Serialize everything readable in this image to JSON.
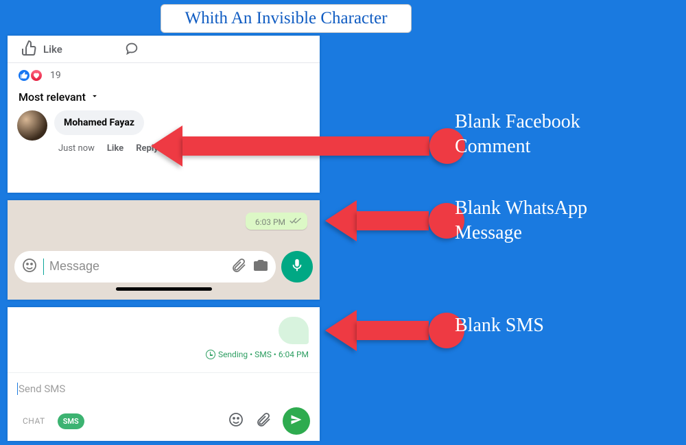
{
  "title": "Whith An Invisible Character",
  "facebook": {
    "like_label": "Like",
    "reaction_count": "19",
    "sort_label": "Most relevant",
    "commenter_name": "Mohamed Fayaz",
    "time_label": "Just now",
    "like_action": "Like",
    "reply_action": "Reply"
  },
  "whatsapp": {
    "bubble_time": "6:03 PM",
    "input_placeholder": "Message"
  },
  "sms": {
    "status_text": "Sending • SMS • 6:04 PM",
    "input_placeholder": "Send SMS",
    "chat_chip": "CHAT",
    "sms_chip": "SMS"
  },
  "annotations": {
    "a1_line1": "Blank Facebook",
    "a1_line2": "Comment",
    "a2_line1": "Blank WhatsApp",
    "a2_line2": "Message",
    "a3_line1": "Blank SMS"
  }
}
